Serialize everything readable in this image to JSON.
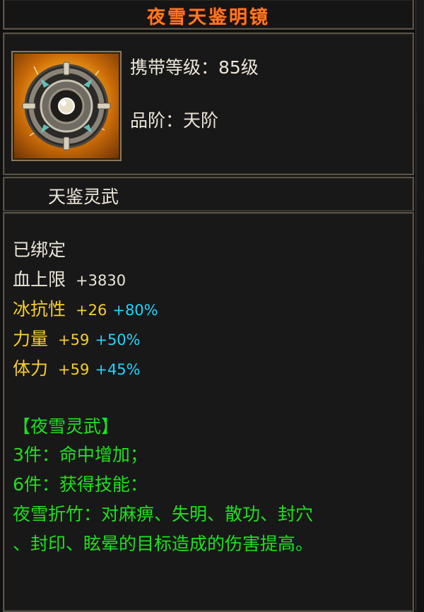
{
  "item": {
    "name": "夜雪天鉴明镜",
    "carry_level": "携带等级：85级",
    "grade": "品阶：天阶",
    "icon": "mirror-shield-icon",
    "series": "天鉴灵武"
  },
  "attributes": {
    "bound": "已绑定",
    "hp": {
      "label": "血上限",
      "value": "+3830"
    },
    "ice_resist": {
      "label": "冰抗性",
      "value": "+26",
      "pct": "+80%"
    },
    "strength": {
      "label": "力量",
      "value": "+59",
      "pct": "+50%"
    },
    "vitality": {
      "label": "体力",
      "value": "+59",
      "pct": "+45%"
    }
  },
  "set_bonus": {
    "title": "【夜雪灵武】",
    "piece3": "3件：命中增加；",
    "piece6": "6件：获得技能：",
    "skill_line1": "夜雪折竹：对麻痹、失明、散功、封穴",
    "skill_line2": "、封印、眩晕的目标造成的伤害提高。"
  },
  "colors": {
    "title": "#ff7a22",
    "white_text": "#ece6d8",
    "yellow_text": "#f6cf27",
    "cyan_text": "#21d4ff",
    "green_text": "#1ee01e"
  }
}
